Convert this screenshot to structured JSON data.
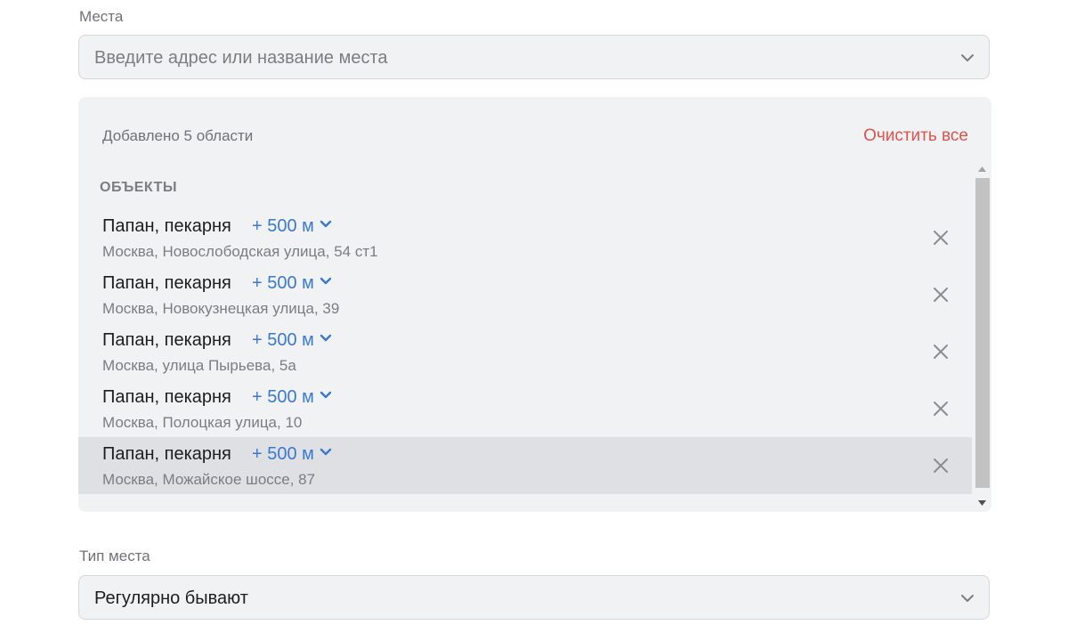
{
  "places": {
    "label": "Места",
    "placeholder": "Введите адрес или название места"
  },
  "selected": {
    "count_text": "Добавлено 5 области",
    "clear_label": "Очистить все",
    "section_title": "ОБЪЕКТЫ",
    "items": [
      {
        "name": "Папан, пекарня",
        "radius": "+ 500 м",
        "address": "Москва, Новослободская улица, 54 ст1"
      },
      {
        "name": "Папан, пекарня",
        "radius": "+ 500 м",
        "address": "Москва, Новокузнецкая улица, 39"
      },
      {
        "name": "Папан, пекарня",
        "radius": "+ 500 м",
        "address": "Москва, улица Пырьева, 5а"
      },
      {
        "name": "Папан, пекарня",
        "radius": "+ 500 м",
        "address": "Москва, Полоцкая улица, 10"
      },
      {
        "name": "Папан, пекарня",
        "radius": "+ 500 м",
        "address": "Москва, Можайское шоссе, 87"
      }
    ]
  },
  "place_type": {
    "label": "Тип места",
    "value": "Регулярно бывают"
  },
  "icons": {
    "chevron": "chevron-down-icon",
    "remove": "close-icon"
  },
  "colors": {
    "accent": "#3a79d1",
    "danger": "#e0524b",
    "highlight_row": "#dfe0e4"
  }
}
